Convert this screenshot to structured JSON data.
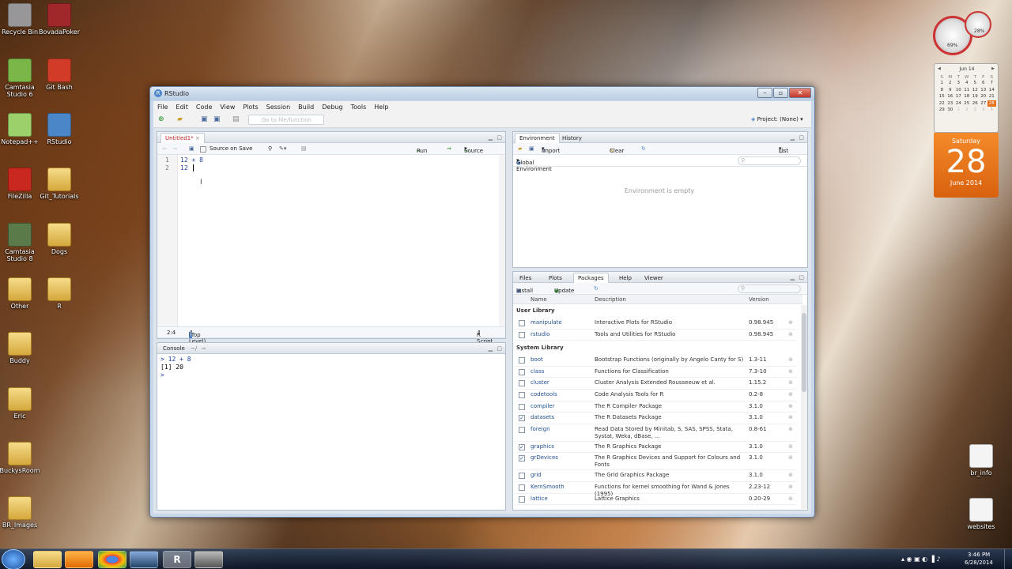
{
  "desktop": {
    "icons": [
      {
        "label": "Recycle Bin"
      },
      {
        "label": "BovadaPoker"
      },
      {
        "label": "Camtasia Studio 6"
      },
      {
        "label": "Git Bash"
      },
      {
        "label": "Notepad++"
      },
      {
        "label": "RStudio"
      },
      {
        "label": "FileZilla"
      },
      {
        "label": "Git_Tutorials"
      },
      {
        "label": "Camtasia Studio 8"
      },
      {
        "label": "Dogs"
      },
      {
        "label": "Other"
      },
      {
        "label": "R"
      },
      {
        "label": "Buddy"
      },
      {
        "label": "Eric"
      },
      {
        "label": "BuckysRoom"
      },
      {
        "label": "BR_Images"
      },
      {
        "label": "br_info"
      },
      {
        "label": "websites"
      }
    ]
  },
  "gadgets": {
    "meter1": "69%",
    "meter2": "28%",
    "calendar": {
      "month": "Jun 14",
      "days": [
        "S",
        "M",
        "T",
        "W",
        "T",
        "F",
        "S"
      ],
      "weeks": [
        [
          "1",
          "2",
          "3",
          "4",
          "5",
          "6",
          "7"
        ],
        [
          "8",
          "9",
          "10",
          "11",
          "12",
          "13",
          "14"
        ],
        [
          "15",
          "16",
          "17",
          "18",
          "19",
          "20",
          "21"
        ],
        [
          "22",
          "23",
          "24",
          "25",
          "26",
          "27",
          "28"
        ],
        [
          "29",
          "30",
          "1",
          "2",
          "3",
          "4",
          "5"
        ]
      ]
    },
    "weekday": "Saturday",
    "day": "28",
    "monthyear": "June 2014"
  },
  "window": {
    "title": "RStudio",
    "menu": [
      "File",
      "Edit",
      "Code",
      "View",
      "Plots",
      "Session",
      "Build",
      "Debug",
      "Tools",
      "Help"
    ],
    "goto_placeholder": "Go to file/function",
    "project": "Project: (None)"
  },
  "editor": {
    "tab": "Untitled1*",
    "source_on_save": "Source on Save",
    "run": "Run",
    "source": "Source",
    "lines": [
      {
        "n": "1",
        "code": "12 + 8"
      },
      {
        "n": "2",
        "code": "12"
      }
    ],
    "position": "2:4",
    "scope": "(Top Level)",
    "filetype": "R Script"
  },
  "console": {
    "title": "Console",
    "path": "~/",
    "lines": [
      "> 12 + 8",
      "[1] 20",
      ">"
    ]
  },
  "environment": {
    "tabs": [
      "Environment",
      "History"
    ],
    "import": "Import Dataset",
    "clear": "Clear",
    "view": "List",
    "scope": "Global Environment",
    "empty": "Environment is empty"
  },
  "packages": {
    "tabs": [
      "Files",
      "Plots",
      "Packages",
      "Help",
      "Viewer"
    ],
    "install": "Install",
    "update": "Update",
    "headers": {
      "name": "Name",
      "description": "Description",
      "version": "Version"
    },
    "user_label": "User Library",
    "system_label": "System Library",
    "user": [
      {
        "name": "manipulate",
        "desc": "Interactive Plots for RStudio",
        "ver": "0.98.945",
        "checked": false
      },
      {
        "name": "rstudio",
        "desc": "Tools and Utilities for RStudio",
        "ver": "0.98.945",
        "checked": false
      }
    ],
    "system": [
      {
        "name": "boot",
        "desc": "Bootstrap Functions (originally by Angelo Canty for S)",
        "ver": "1.3-11",
        "checked": false
      },
      {
        "name": "class",
        "desc": "Functions for Classification",
        "ver": "7.3-10",
        "checked": false
      },
      {
        "name": "cluster",
        "desc": "Cluster Analysis Extended Rousseeuw et al.",
        "ver": "1.15.2",
        "checked": false
      },
      {
        "name": "codetools",
        "desc": "Code Analysis Tools for R",
        "ver": "0.2-8",
        "checked": false
      },
      {
        "name": "compiler",
        "desc": "The R Compiler Package",
        "ver": "3.1.0",
        "checked": false
      },
      {
        "name": "datasets",
        "desc": "The R Datasets Package",
        "ver": "3.1.0",
        "checked": true
      },
      {
        "name": "foreign",
        "desc": "Read Data Stored by Minitab, S, SAS, SPSS, Stata, Systat, Weka, dBase, ...",
        "ver": "0.8-61",
        "checked": false
      },
      {
        "name": "graphics",
        "desc": "The R Graphics Package",
        "ver": "3.1.0",
        "checked": true
      },
      {
        "name": "grDevices",
        "desc": "The R Graphics Devices and Support for Colours and Fonts",
        "ver": "3.1.0",
        "checked": true
      },
      {
        "name": "grid",
        "desc": "The Grid Graphics Package",
        "ver": "3.1.0",
        "checked": false
      },
      {
        "name": "KernSmooth",
        "desc": "Functions for kernel smoothing for Wand & Jones (1995)",
        "ver": "2.23-12",
        "checked": false
      },
      {
        "name": "lattice",
        "desc": "Lattice Graphics",
        "ver": "0.20-29",
        "checked": false
      }
    ]
  },
  "taskbar": {
    "time": "3:46 PM",
    "date": "6/28/2014"
  }
}
